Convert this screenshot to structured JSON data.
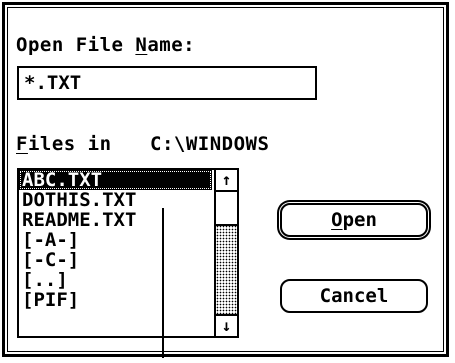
{
  "dialog": {
    "filename_label_pre": "Open File ",
    "filename_label_hot": "N",
    "filename_label_post": "ame:",
    "filename_value": "*.TXT",
    "files_label_hot": "F",
    "files_label_rest": "iles in",
    "current_dir": "C:\\WINDOWS",
    "files": [
      "ABC.TXT",
      "DOTHIS.TXT",
      "README.TXT",
      "[-A-]",
      "[-C-]",
      "[..]",
      "[PIF]"
    ],
    "selected_index": 0,
    "scroll_up_glyph": "↑",
    "scroll_down_glyph": "↓",
    "open_hot": "O",
    "open_rest": "pen",
    "cancel_label": "Cancel"
  }
}
